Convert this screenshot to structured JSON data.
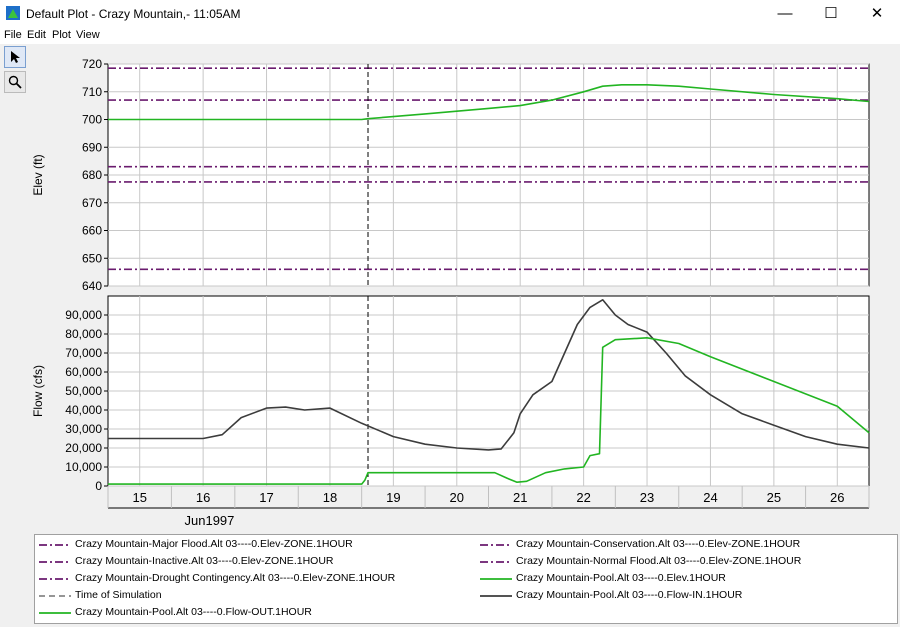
{
  "window": {
    "title": "Default Plot - Crazy Mountain,- 11:05AM",
    "minimize": "—",
    "maximize": "☐",
    "close": "✕"
  },
  "menu": [
    "File",
    "Edit",
    "Plot",
    "View"
  ],
  "tools": [
    {
      "name": "pointer-tool",
      "icon": "arrow-cursor-icon"
    },
    {
      "name": "zoom-tool",
      "icon": "magnifier-icon"
    }
  ],
  "colors": {
    "purple": "#6a1b6e",
    "green": "#22b522",
    "dark": "#3c3c3c",
    "grid": "#c8c8c8"
  },
  "chart_data": [
    {
      "type": "line",
      "ylabel": "Elev (ft)",
      "ylim": [
        640,
        720
      ],
      "yticks": [
        640,
        650,
        660,
        670,
        680,
        690,
        700,
        710,
        720
      ],
      "xlim": [
        14.5,
        26.5
      ],
      "hlines": [
        {
          "name": "Crazy Mountain-Major Flood.Alt 03----0.Elev-ZONE.1HOUR",
          "value": 718.5
        },
        {
          "name": "Crazy Mountain-Normal Flood.Alt 03----0.Elev-ZONE.1HOUR",
          "value": 707
        },
        {
          "name": "Crazy Mountain-Conservation.Alt 03----0.Elev-ZONE.1HOUR",
          "value": 683
        },
        {
          "name": "Crazy Mountain-Drought Contingency.Alt 03----0.Elev-ZONE.1HOUR",
          "value": 677.5
        },
        {
          "name": "Crazy Mountain-Inactive.Alt 03----0.Elev-ZONE.1HOUR",
          "value": 646
        }
      ],
      "series": [
        {
          "name": "Crazy Mountain-Pool.Alt 03----0.Elev.1HOUR",
          "x": [
            14.5,
            18.5,
            18.6,
            19.5,
            20.5,
            21.0,
            21.5,
            22.0,
            22.3,
            22.6,
            23.0,
            23.5,
            24.0,
            25.0,
            26.0,
            26.5
          ],
          "y": [
            700,
            700,
            700.3,
            702,
            704,
            705,
            707,
            710,
            712,
            712.5,
            712.5,
            712,
            711,
            709,
            707.5,
            706.5
          ]
        }
      ],
      "time_of_simulation": 18.6
    },
    {
      "type": "line",
      "ylabel": "Flow (cfs)",
      "ylim": [
        0,
        100000
      ],
      "yticks": [
        0,
        10000,
        20000,
        30000,
        40000,
        50000,
        60000,
        70000,
        80000,
        90000
      ],
      "ytick_labels": [
        "0",
        "10,000",
        "20,000",
        "30,000",
        "40,000",
        "50,000",
        "60,000",
        "70,000",
        "80,000",
        "90,000"
      ],
      "xlim": [
        14.5,
        26.5
      ],
      "xticks": [
        15,
        16,
        17,
        18,
        19,
        20,
        21,
        22,
        23,
        24,
        25,
        26
      ],
      "xtick_labels": [
        "15",
        "16",
        "17",
        "18",
        "19",
        "20",
        "21",
        "22",
        "23",
        "24",
        "25",
        "26"
      ],
      "xlabel": "Jun1997",
      "series": [
        {
          "name": "Crazy Mountain-Pool.Alt 03----0.Flow-IN.1HOUR",
          "x": [
            14.5,
            15.0,
            16.0,
            16.3,
            16.6,
            17.0,
            17.3,
            17.6,
            18.0,
            18.5,
            19.0,
            19.5,
            20.0,
            20.5,
            20.7,
            20.9,
            21.0,
            21.2,
            21.5,
            21.7,
            21.9,
            22.1,
            22.3,
            22.5,
            22.7,
            23.0,
            23.3,
            23.6,
            24.0,
            24.5,
            25.0,
            25.5,
            26.0,
            26.5
          ],
          "y": [
            25000,
            25000,
            25000,
            27000,
            36000,
            41000,
            41500,
            40000,
            41000,
            33000,
            26000,
            22000,
            20000,
            19000,
            19500,
            28000,
            38000,
            48000,
            55000,
            70000,
            85000,
            94000,
            98000,
            90000,
            85000,
            81000,
            70000,
            58000,
            48000,
            38000,
            32000,
            26000,
            22000,
            20000
          ]
        },
        {
          "name": "Crazy Mountain-Pool.Alt 03----0.Flow-OUT.1HOUR",
          "x": [
            14.5,
            18.5,
            18.55,
            18.6,
            20.0,
            20.6,
            20.8,
            20.95,
            21.1,
            21.4,
            21.7,
            22.0,
            22.1,
            22.25,
            22.3,
            22.5,
            23.0,
            23.5,
            24.0,
            25.0,
            26.0,
            26.5
          ],
          "y": [
            1000,
            1000,
            3000,
            7000,
            7000,
            7000,
            4000,
            2000,
            2500,
            7000,
            9000,
            10000,
            16000,
            17000,
            73000,
            77000,
            78000,
            75000,
            68000,
            55000,
            42000,
            28000
          ]
        }
      ],
      "time_of_simulation": 18.6
    }
  ],
  "legend": [
    {
      "label": "Crazy Mountain-Major Flood.Alt 03----0.Elev-ZONE.1HOUR",
      "style": "dashdot",
      "color": "#6a1b6e"
    },
    {
      "label": "Crazy Mountain-Conservation.Alt 03----0.Elev-ZONE.1HOUR",
      "style": "dashdot",
      "color": "#6a1b6e"
    },
    {
      "label": "Crazy Mountain-Inactive.Alt 03----0.Elev-ZONE.1HOUR",
      "style": "dashdot",
      "color": "#6a1b6e"
    },
    {
      "label": "Crazy Mountain-Normal Flood.Alt 03----0.Elev-ZONE.1HOUR",
      "style": "dashdot",
      "color": "#6a1b6e"
    },
    {
      "label": "Crazy Mountain-Drought Contingency.Alt 03----0.Elev-ZONE.1HOUR",
      "style": "dashdot",
      "color": "#6a1b6e"
    },
    {
      "label": "Crazy Mountain-Pool.Alt 03----0.Elev.1HOUR",
      "style": "solid",
      "color": "#22b522"
    },
    {
      "label": "Time of Simulation",
      "style": "dash",
      "color": "#888888"
    },
    {
      "label": "Crazy Mountain-Pool.Alt 03----0.Flow-IN.1HOUR",
      "style": "solid",
      "color": "#3c3c3c"
    },
    {
      "label": "Crazy Mountain-Pool.Alt 03----0.Flow-OUT.1HOUR",
      "style": "solid",
      "color": "#22b522"
    }
  ]
}
